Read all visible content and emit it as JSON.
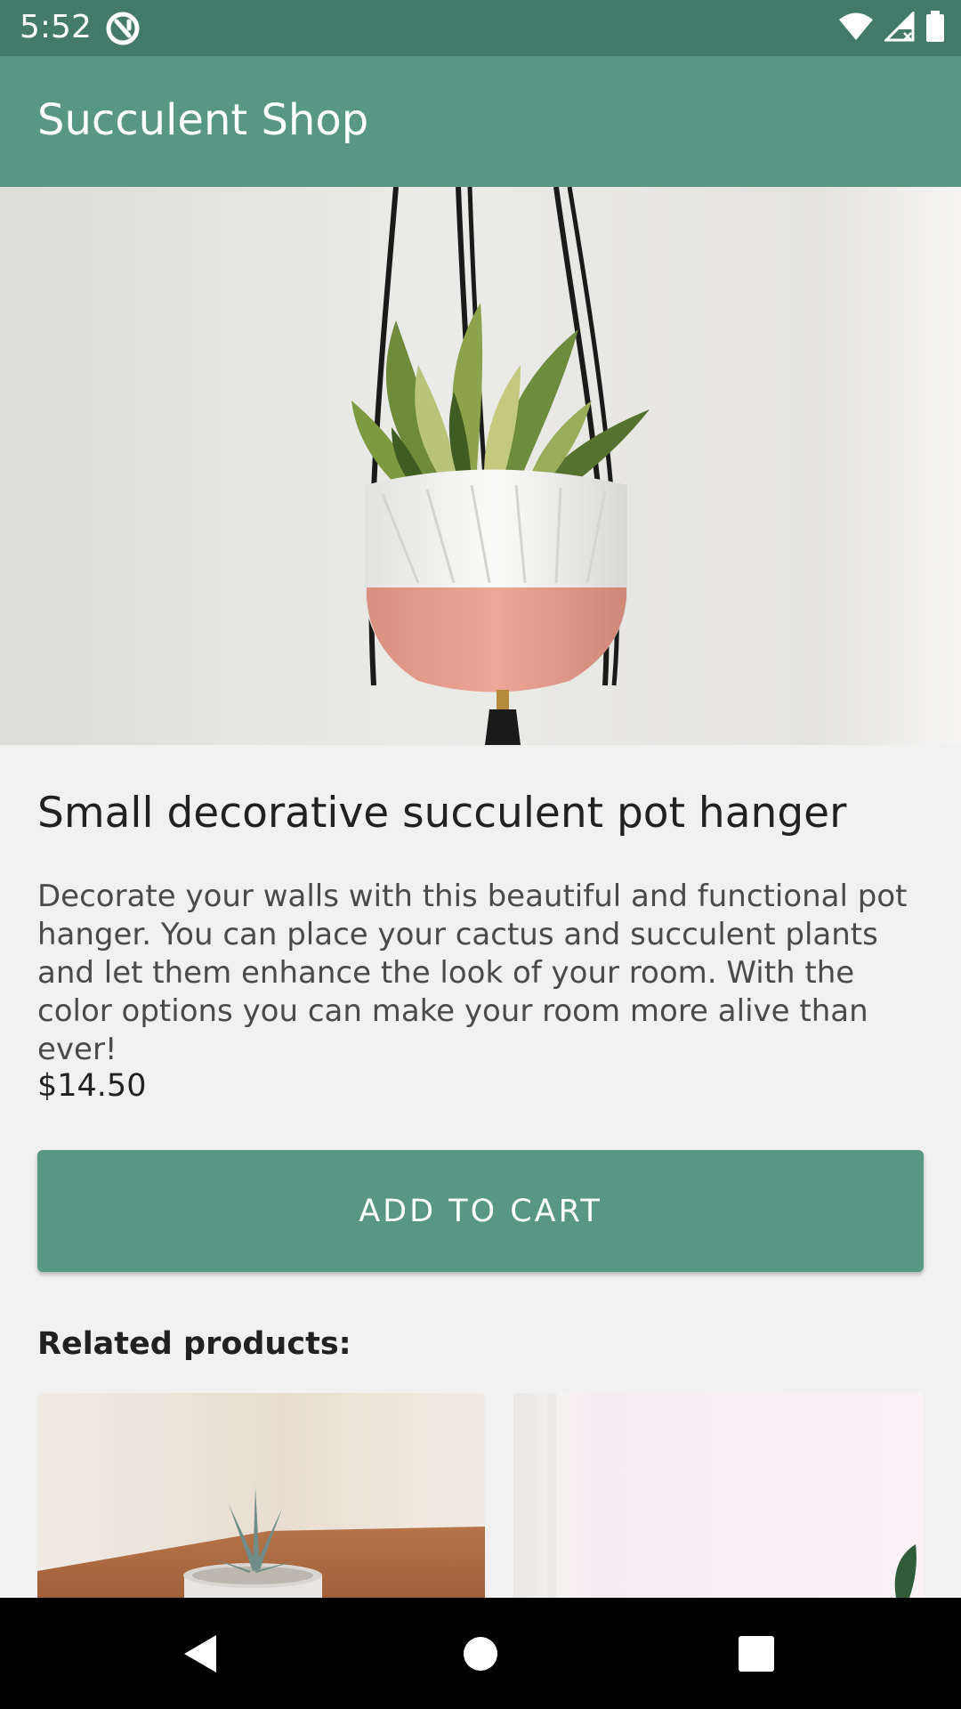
{
  "status_bar": {
    "time": "5:52",
    "icons": [
      "app-notification-icon",
      "wifi-icon",
      "cell-signal-icon",
      "battery-icon"
    ]
  },
  "app_bar": {
    "title": "Succulent Shop"
  },
  "product": {
    "image_icon": "hanging-succulent-pot-image",
    "title": "Small decorative succulent pot hanger",
    "description": "Decorate your walls with this beautiful and functional pot hanger. You can place your cactus and succulent plants and let them enhance the look of your room. With the color options you can make your room more alive than ever!",
    "price": "$14.50",
    "add_to_cart_label": "ADD TO CART"
  },
  "related": {
    "heading": "Related products:",
    "items": [
      {
        "image_icon": "succulent-on-table-image"
      },
      {
        "image_icon": "plant-by-pink-wall-image"
      }
    ]
  },
  "nav_bar": {
    "icons": [
      "back-icon",
      "home-icon",
      "recents-icon"
    ]
  },
  "colors": {
    "status_bar": "#447a69",
    "primary": "#579783",
    "background": "#f1f1f1",
    "nav_bar": "#000000"
  }
}
